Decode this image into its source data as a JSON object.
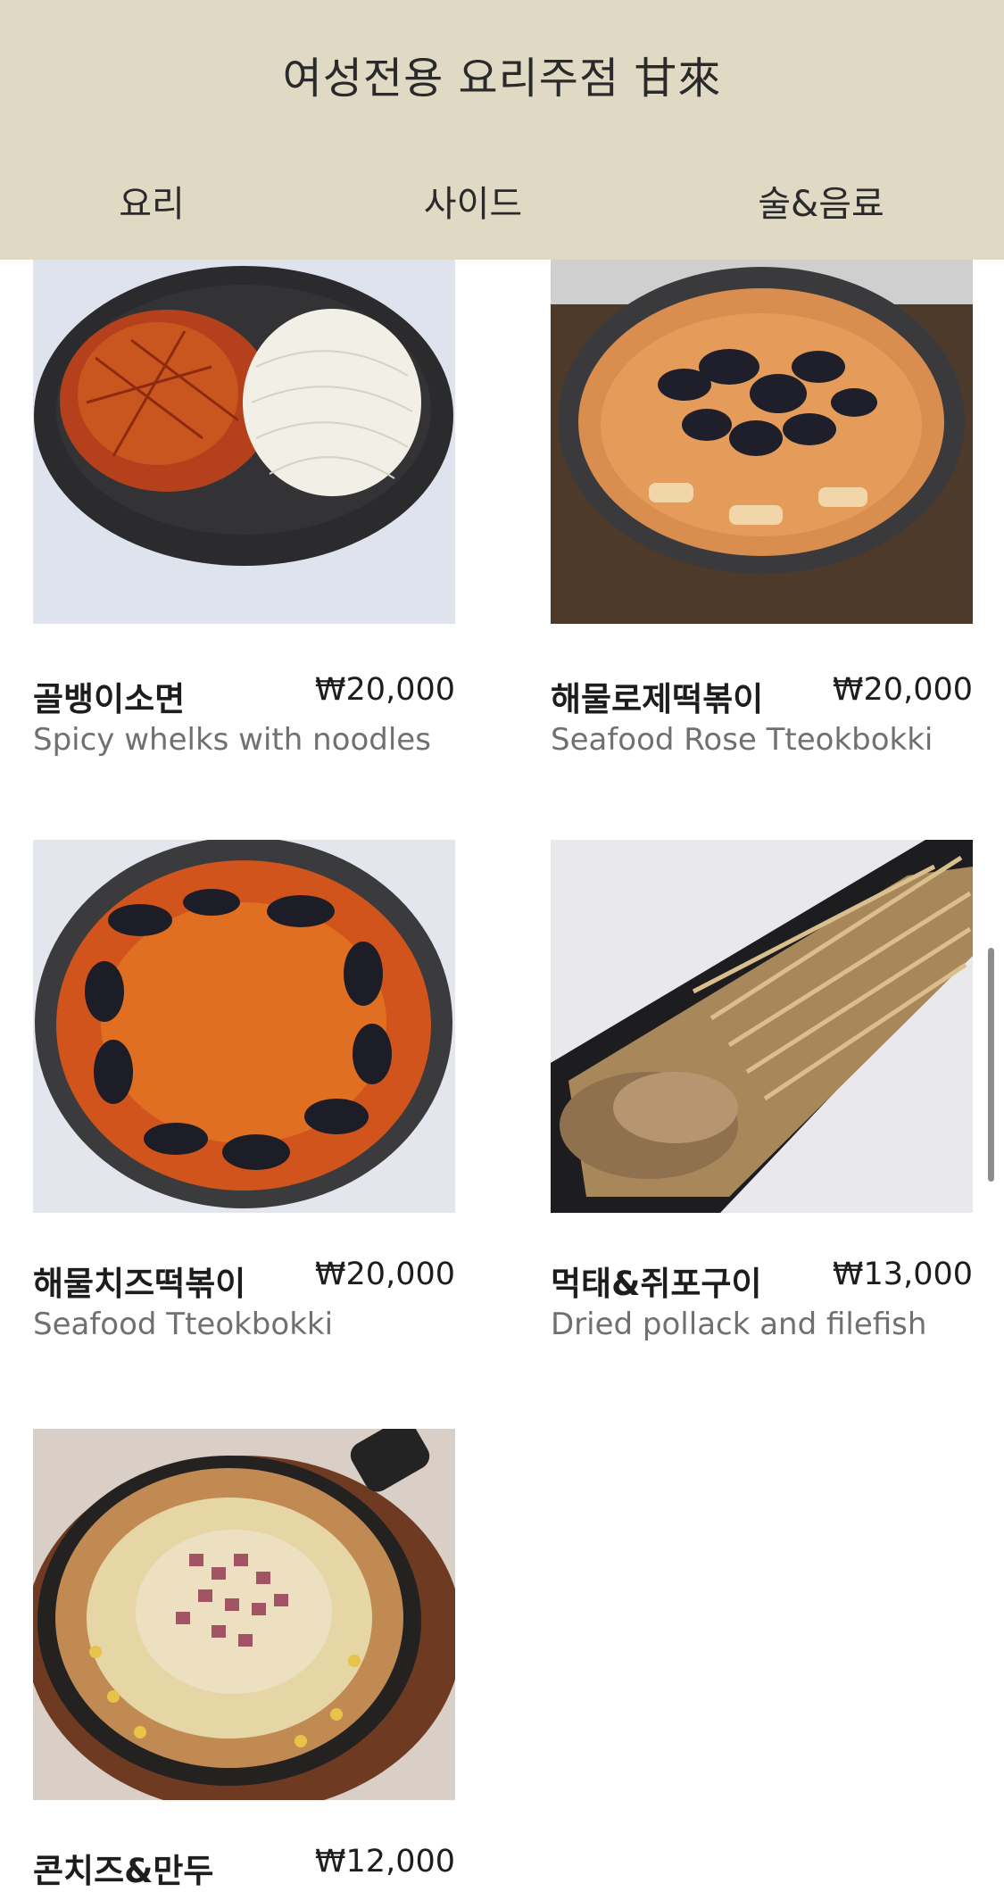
{
  "header": {
    "title": "여성전용 요리주점 甘來",
    "tabs": [
      {
        "label": "요리"
      },
      {
        "label": "사이드"
      },
      {
        "label": "술&음료"
      }
    ]
  },
  "menu": {
    "items": [
      {
        "name": "골뱅이소면",
        "price": "₩20,000",
        "desc": "Spicy whelks with noodles"
      },
      {
        "name": "해물로제떡볶이",
        "price": "₩20,000",
        "desc": "Seafood Rose Tteokbokki"
      },
      {
        "name": "해물치즈떡볶이",
        "price": "₩20,000",
        "desc": "Seafood Tteokbokki"
      },
      {
        "name": "먹태&쥐포구이",
        "price": "₩13,000",
        "desc": "Dried pollack and filefish"
      },
      {
        "name": "콘치즈&만두",
        "price": "₩12,000",
        "desc": ""
      }
    ]
  },
  "colors": {
    "header_bg": "#e0d9c4",
    "text": "#1d1d1d",
    "desc_text": "#707070"
  }
}
